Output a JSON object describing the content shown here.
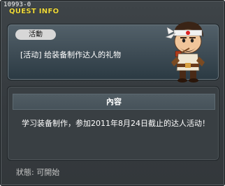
{
  "window": {
    "quest_id": "10993-0",
    "title": "QUEST INFO"
  },
  "quest": {
    "category_tag": "活動",
    "name": "[活动] 给装备制作达人的礼物"
  },
  "content": {
    "header": "內容",
    "description": "学习装备制作，参加2011年8月24日截止的达人活动！"
  },
  "status": {
    "text": "狀態:  可開始"
  },
  "colors": {
    "title_yellow": "#f2dd3c",
    "panel_dark": "#393f43",
    "header_bar": "#4e5a62"
  },
  "icons": {
    "npc": "npc-character-with-headband-and-pipe"
  }
}
